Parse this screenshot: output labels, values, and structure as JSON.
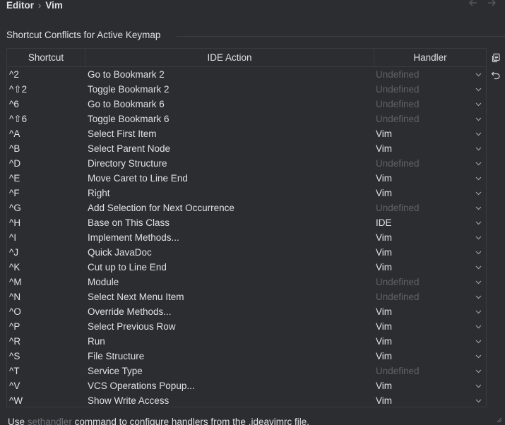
{
  "breadcrumb": {
    "parent": "Editor",
    "separator": "›",
    "current": "Vim"
  },
  "nav": {
    "back_icon": "arrow-left-icon",
    "forward_icon": "arrow-right-icon"
  },
  "section": {
    "title": "Shortcut Conflicts for Active Keymap"
  },
  "table": {
    "columns": [
      "Shortcut",
      "IDE Action",
      "Handler"
    ],
    "rows": [
      {
        "shortcut": "^2",
        "action": "Go to Bookmark 2",
        "handler": "Undefined"
      },
      {
        "shortcut": "^⇧2",
        "action": "Toggle Bookmark 2",
        "handler": "Undefined"
      },
      {
        "shortcut": "^6",
        "action": "Go to Bookmark 6",
        "handler": "Undefined"
      },
      {
        "shortcut": "^⇧6",
        "action": "Toggle Bookmark 6",
        "handler": "Undefined"
      },
      {
        "shortcut": "^A",
        "action": "Select First Item",
        "handler": "Vim"
      },
      {
        "shortcut": "^B",
        "action": "Select Parent Node",
        "handler": "Vim"
      },
      {
        "shortcut": "^D",
        "action": "Directory Structure",
        "handler": "Undefined"
      },
      {
        "shortcut": "^E",
        "action": "Move Caret to Line End",
        "handler": "Vim"
      },
      {
        "shortcut": "^F",
        "action": "Right",
        "handler": "Vim"
      },
      {
        "shortcut": "^G",
        "action": "Add Selection for Next Occurrence",
        "handler": "Undefined"
      },
      {
        "shortcut": "^H",
        "action": "Base on This Class",
        "handler": "IDE"
      },
      {
        "shortcut": "^I",
        "action": "Implement Methods...",
        "handler": "Vim"
      },
      {
        "shortcut": "^J",
        "action": "Quick JavaDoc",
        "handler": "Vim"
      },
      {
        "shortcut": "^K",
        "action": "Cut up to Line End",
        "handler": "Vim"
      },
      {
        "shortcut": "^M",
        "action": "Module",
        "handler": "Undefined"
      },
      {
        "shortcut": "^N",
        "action": "Select Next Menu Item",
        "handler": "Undefined"
      },
      {
        "shortcut": "^O",
        "action": "Override Methods...",
        "handler": "Vim"
      },
      {
        "shortcut": "^P",
        "action": "Select Previous Row",
        "handler": "Vim"
      },
      {
        "shortcut": "^R",
        "action": "Run",
        "handler": "Vim"
      },
      {
        "shortcut": "^S",
        "action": "File Structure",
        "handler": "Vim"
      },
      {
        "shortcut": "^T",
        "action": "Service Type",
        "handler": "Undefined"
      },
      {
        "shortcut": "^V",
        "action": "VCS Operations Popup...",
        "handler": "Vim"
      },
      {
        "shortcut": "^W",
        "action": "Show Write Access",
        "handler": "Vim"
      }
    ]
  },
  "side_tools": {
    "copy_icon": "copy-icon",
    "reset_icon": "undo-icon"
  },
  "footer": {
    "prefix": "Use ",
    "code": "sethandler",
    "suffix": " command to configure handlers from the .ideavimrc file."
  },
  "colors": {
    "background": "#2b2d30",
    "text": "#dfe1e5",
    "muted": "#5f6268",
    "border": "#393b40"
  }
}
